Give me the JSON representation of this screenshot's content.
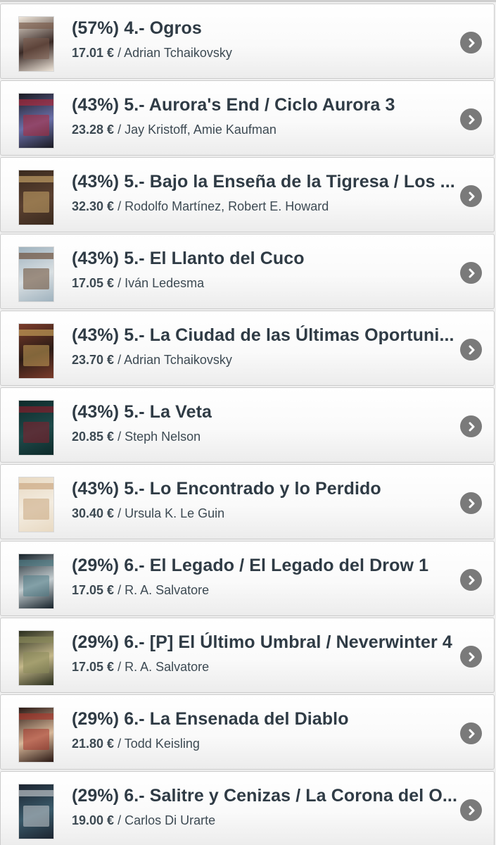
{
  "books": [
    {
      "title": "(57%) 4.- Ogros",
      "price": "17.01 €",
      "sep": "/",
      "authors": "Adrian Tchaikovsky",
      "cover_colors": [
        "#efe6da",
        "#7a5a4a",
        "#3a2a26"
      ]
    },
    {
      "title": "(43%) 5.- Aurora's End / Ciclo Aurora 3",
      "price": "23.28 €",
      "sep": "/",
      "authors": "Jay Kristoff, Amie Kaufman",
      "cover_colors": [
        "#1a1a22",
        "#b0283a",
        "#6a6fa8"
      ]
    },
    {
      "title": "(43%) 5.- Bajo la Enseña de la Tigresa / Los ...",
      "price": "32.30 €",
      "sep": "/",
      "authors": "Rodolfo Martínez, Robert E. Howard",
      "cover_colors": [
        "#3a2a1e",
        "#c9a66a",
        "#5a4030"
      ]
    },
    {
      "title": "(43%) 5.- El Llanto del Cuco",
      "price": "17.05 €",
      "sep": "/",
      "authors": "Iván Ledesma",
      "cover_colors": [
        "#9fb2be",
        "#6a4a32",
        "#d9dfe2"
      ]
    },
    {
      "title": "(43%) 5.- La Ciudad de las Últimas Oportuni...",
      "price": "23.70 €",
      "sep": "/",
      "authors": "Adrian Tchaikovsky",
      "cover_colors": [
        "#7a3b2a",
        "#c8a35a",
        "#2c1c16"
      ]
    },
    {
      "title": "(43%) 5.- La Veta",
      "price": "20.85 €",
      "sep": "/",
      "authors": "Steph Nelson",
      "cover_colors": [
        "#0e2a2a",
        "#8a1c2a",
        "#1e4a4a"
      ]
    },
    {
      "title": "(43%) 5.- Lo Encontrado y lo Perdido",
      "price": "30.40 €",
      "sep": "/",
      "authors": "Ursula K. Le Guin",
      "cover_colors": [
        "#e8d9c2",
        "#c9a57e",
        "#f3ece0"
      ]
    },
    {
      "title": "(29%) 6.- El Legado / El Legado del Drow 1",
      "price": "17.05 €",
      "sep": "/",
      "authors": "R. A. Salvatore",
      "cover_colors": [
        "#16222a",
        "#4f7c86",
        "#c4cdd0"
      ]
    },
    {
      "title": "(29%) 6.- [P] El Último Umbral / Neverwinter 4",
      "price": "17.05 €",
      "sep": "/",
      "authors": "R. A. Salvatore",
      "cover_colors": [
        "#2a2e1e",
        "#8a8a5a",
        "#c4b88a"
      ]
    },
    {
      "title": "(29%) 6.- La Ensenada del Diablo",
      "price": "21.80 €",
      "sep": "/",
      "authors": "Todd Keisling",
      "cover_colors": [
        "#2a1814",
        "#a8342a",
        "#d8b89a"
      ]
    },
    {
      "title": "(29%) 6.- Salitre y Cenizas / La Corona del O...",
      "price": "19.00 €",
      "sep": "/",
      "authors": "Carlos Di Urarte",
      "cover_colors": [
        "#1c2430",
        "#c8ccd0",
        "#3a5a6a"
      ]
    }
  ],
  "icons": {
    "row_action": "chevron-right-circle-icon"
  },
  "colors": {
    "title": "#2f3b45",
    "text": "#3d4a53",
    "arrow_bg": "#7a7a7a",
    "background": "#f0f0f0"
  }
}
